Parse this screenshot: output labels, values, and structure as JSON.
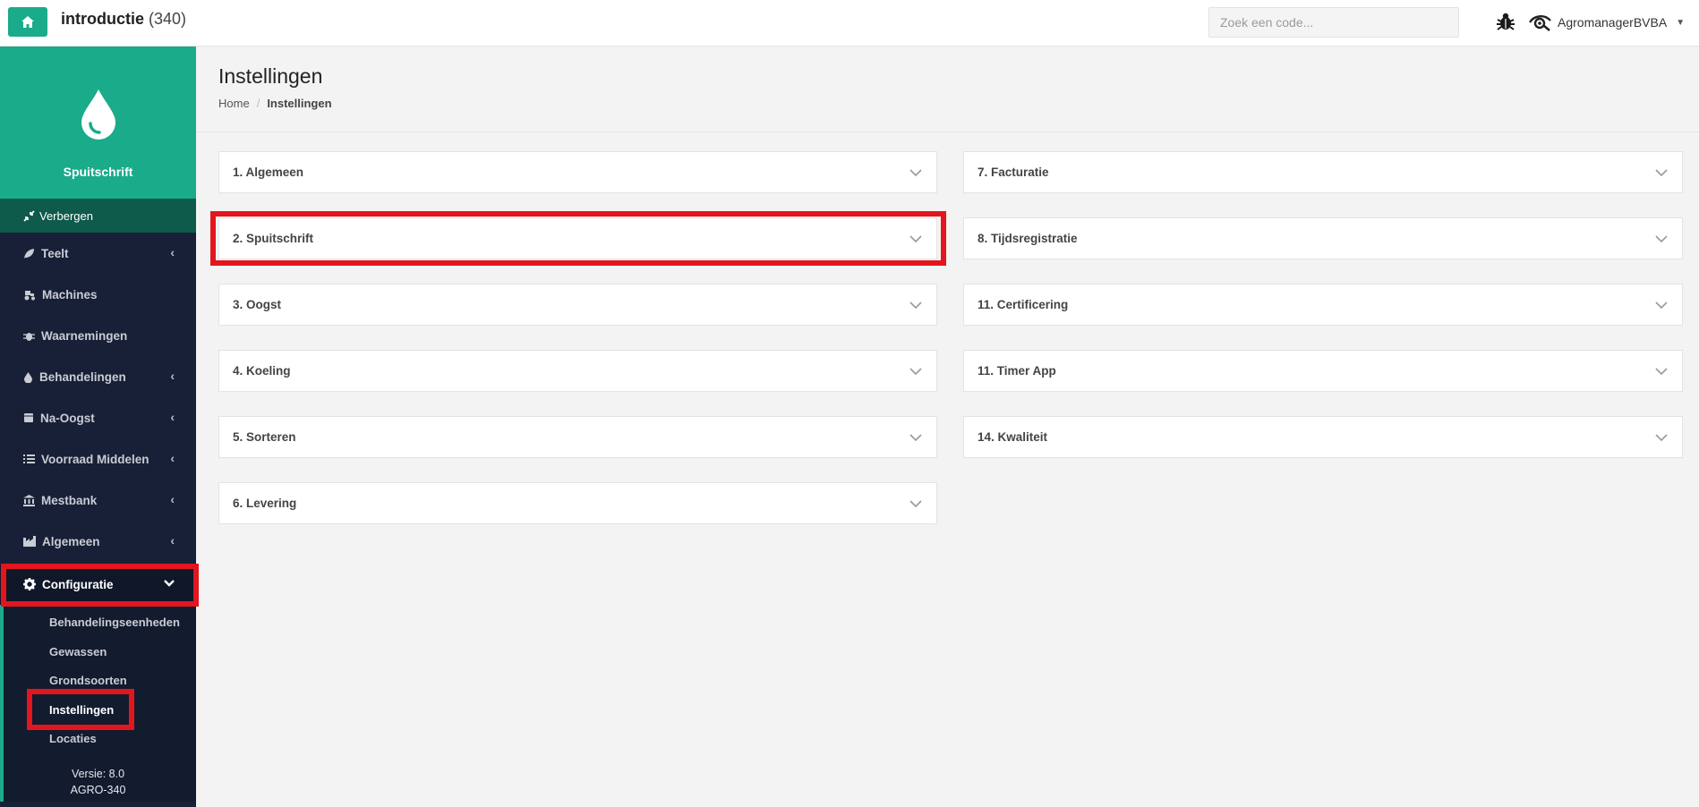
{
  "header": {
    "title": "introductie",
    "count": "(340)",
    "search_placeholder": "Zoek een code...",
    "user": "AgromanagerBVBA",
    "icons": [
      "home-icon",
      "bug-icon",
      "eye-icon",
      "caret-down-icon"
    ],
    "accent": "#1aab8a"
  },
  "sidebar": {
    "brand_label": "Spuitschrift",
    "hide_label": "Verbergen",
    "items": [
      {
        "label": "Teelt",
        "icon": "leaf-icon",
        "has_chevron": true
      },
      {
        "label": "Machines",
        "icon": "tractor-icon",
        "has_chevron": false
      },
      {
        "label": "Waarnemingen",
        "icon": "bug-icon",
        "has_chevron": false
      },
      {
        "label": "Behandelingen",
        "icon": "drop-icon",
        "has_chevron": true
      },
      {
        "label": "Na-Oogst",
        "icon": "box-icon",
        "has_chevron": true
      },
      {
        "label": "Voorraad Middelen",
        "icon": "list-icon",
        "has_chevron": true
      },
      {
        "label": "Mestbank",
        "icon": "bank-icon",
        "has_chevron": true
      },
      {
        "label": "Algemeen",
        "icon": "industry-icon",
        "has_chevron": true
      },
      {
        "label": "Configuratie",
        "icon": "gear-icon",
        "has_chevron": true,
        "expanded": true
      }
    ],
    "sub_items": [
      {
        "label": "Behandelingseenheden"
      },
      {
        "label": "Gewassen"
      },
      {
        "label": "Grondsoorten"
      },
      {
        "label": "Instellingen",
        "active": true
      },
      {
        "label": "Locaties"
      }
    ],
    "version": "Versie: 8.0",
    "build": "AGRO-340"
  },
  "page": {
    "title": "Instellingen",
    "breadcrumb": {
      "home": "Home",
      "separator": "/",
      "current": "Instellingen"
    }
  },
  "panels_left": [
    {
      "label": "1. Algemeen"
    },
    {
      "label": "2. Spuitschrift"
    },
    {
      "label": "3. Oogst"
    },
    {
      "label": "4. Koeling"
    },
    {
      "label": "5. Sorteren"
    },
    {
      "label": "6. Levering"
    }
  ],
  "panels_right": [
    {
      "label": "7. Facturatie"
    },
    {
      "label": "8. Tijdsregistratie"
    },
    {
      "label": "11. Certificering"
    },
    {
      "label": "11. Timer App"
    },
    {
      "label": "14. Kwaliteit"
    }
  ],
  "highlight_color": "#e3161e"
}
